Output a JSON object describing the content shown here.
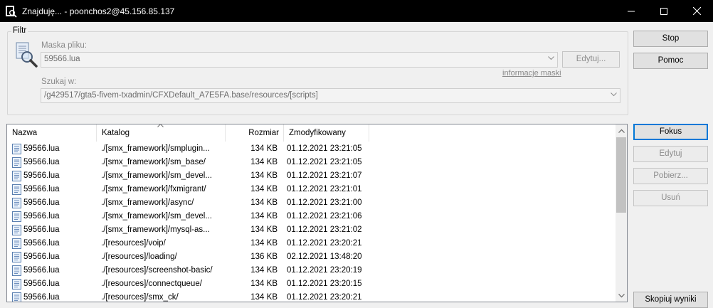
{
  "window": {
    "title": "Znajduję... - poonchos2@45.156.85.137"
  },
  "filter": {
    "group_label": "Filtr",
    "mask_label": "Maska pliku:",
    "mask_value": "59566.lua",
    "edit_button": "Edytuj...",
    "mask_info_link": "informacje maski",
    "search_in_label": "Szukaj w:",
    "search_in_value": "/g429517/gta5-fivem-txadmin/CFXDefault_A7E5FA.base/resources/[scripts]"
  },
  "side_buttons": {
    "stop": "Stop",
    "help": "Pomoc",
    "focus": "Fokus",
    "edit": "Edytuj",
    "download": "Pobierz...",
    "delete": "Usuń",
    "copy_results": "Skopiuj wyniki"
  },
  "columns": {
    "name": "Nazwa",
    "directory": "Katalog",
    "size": "Rozmiar",
    "modified": "Zmodyfikowany"
  },
  "rows": [
    {
      "name": "59566.lua",
      "dir": "./[smx_framework]/smplugin...",
      "size": "134 KB",
      "modified": "01.12.2021 23:21:05"
    },
    {
      "name": "59566.lua",
      "dir": "./[smx_framework]/sm_base/",
      "size": "134 KB",
      "modified": "01.12.2021 23:21:05"
    },
    {
      "name": "59566.lua",
      "dir": "./[smx_framework]/sm_devel...",
      "size": "134 KB",
      "modified": "01.12.2021 23:21:07"
    },
    {
      "name": "59566.lua",
      "dir": "./[smx_framework]/fxmigrant/",
      "size": "134 KB",
      "modified": "01.12.2021 23:21:01"
    },
    {
      "name": "59566.lua",
      "dir": "./[smx_framework]/async/",
      "size": "134 KB",
      "modified": "01.12.2021 23:21:00"
    },
    {
      "name": "59566.lua",
      "dir": "./[smx_framework]/sm_devel...",
      "size": "134 KB",
      "modified": "01.12.2021 23:21:06"
    },
    {
      "name": "59566.lua",
      "dir": "./[smx_framework]/mysql-as...",
      "size": "134 KB",
      "modified": "01.12.2021 23:21:02"
    },
    {
      "name": "59566.lua",
      "dir": "./[resources]/voip/",
      "size": "134 KB",
      "modified": "01.12.2021 23:20:21"
    },
    {
      "name": "59566.lua",
      "dir": "./[resources]/loading/",
      "size": "136 KB",
      "modified": "02.12.2021 13:48:20"
    },
    {
      "name": "59566.lua",
      "dir": "./[resources]/screenshot-basic/",
      "size": "134 KB",
      "modified": "01.12.2021 23:20:19"
    },
    {
      "name": "59566.lua",
      "dir": "./[resources]/connectqueue/",
      "size": "134 KB",
      "modified": "01.12.2021 23:20:15"
    },
    {
      "name": "59566.lua",
      "dir": "./[resources]/smx_ck/",
      "size": "134 KB",
      "modified": "01.12.2021 23:20:21"
    }
  ],
  "colors": {
    "titlebar": "#000000",
    "focus_accent": "#0078d7",
    "window_bg": "#f0f0f0"
  }
}
